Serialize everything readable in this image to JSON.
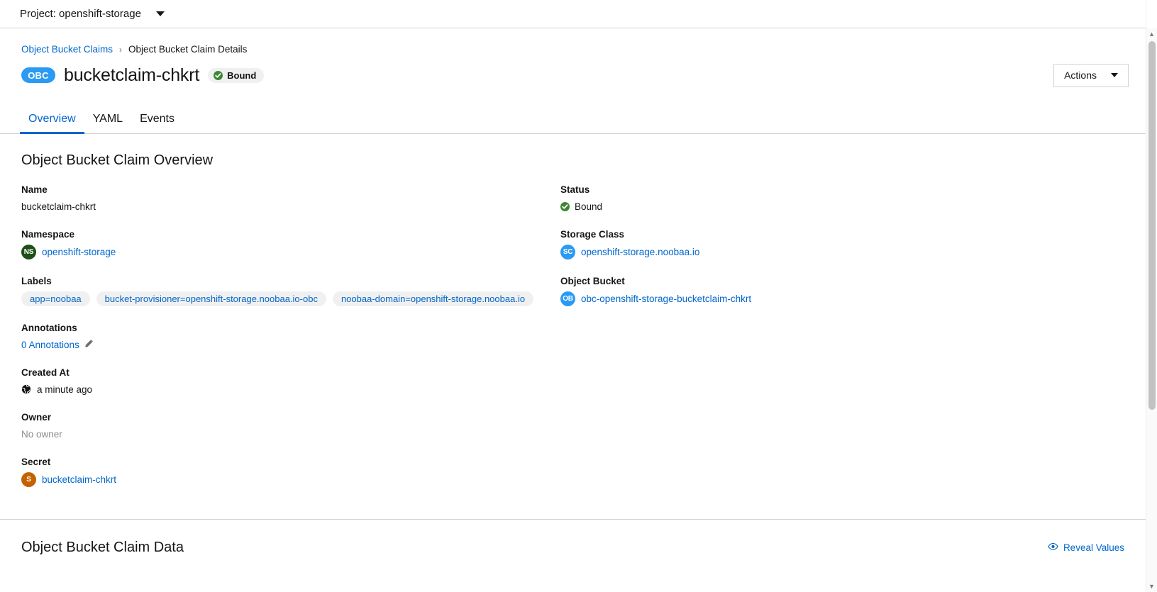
{
  "project_bar": {
    "label": "Project: openshift-storage",
    "caret_icon": "chevron-down-icon"
  },
  "breadcrumb": {
    "parent": "Object Bucket Claims",
    "separator": "›",
    "current": "Object Bucket Claim Details"
  },
  "header": {
    "kind_badge": "OBC",
    "title": "bucketclaim-chkrt",
    "status": "Bound",
    "status_icon": "check-circle-icon",
    "actions_label": "Actions"
  },
  "tabs": [
    {
      "label": "Overview",
      "active": true
    },
    {
      "label": "YAML",
      "active": false
    },
    {
      "label": "Events",
      "active": false
    }
  ],
  "overview": {
    "title": "Object Bucket Claim Overview",
    "left": {
      "name_label": "Name",
      "name_value": "bucketclaim-chkrt",
      "namespace_label": "Namespace",
      "namespace_badge": "NS",
      "namespace_value": "openshift-storage",
      "labels_label": "Labels",
      "labels": [
        "app=noobaa",
        "bucket-provisioner=openshift-storage.noobaa.io-obc",
        "noobaa-domain=openshift-storage.noobaa.io"
      ],
      "annotations_label": "Annotations",
      "annotations_value": "0 Annotations",
      "annotations_edit_icon": "pencil-icon",
      "created_at_label": "Created At",
      "created_at_icon": "globe-icon",
      "created_at_value": "a minute ago",
      "owner_label": "Owner",
      "owner_value": "No owner",
      "secret_label": "Secret",
      "secret_badge": "S",
      "secret_value": "bucketclaim-chkrt"
    },
    "right": {
      "status_label": "Status",
      "status_value": "Bound",
      "status_icon": "check-circle-icon",
      "storage_class_label": "Storage Class",
      "storage_class_badge": "SC",
      "storage_class_value": "openshift-storage.noobaa.io",
      "object_bucket_label": "Object Bucket",
      "object_bucket_badge": "OB",
      "object_bucket_value": "obc-openshift-storage-bucketclaim-chkrt"
    }
  },
  "data_section": {
    "title": "Object Bucket Claim Data",
    "reveal_label": "Reveal Values",
    "reveal_icon": "eye-icon"
  },
  "colors": {
    "link": "#0066cc",
    "accent_blue": "#2b9af3",
    "success_green": "#3e8635",
    "namespace_green": "#1e4f18",
    "secret_orange": "#c46100"
  }
}
